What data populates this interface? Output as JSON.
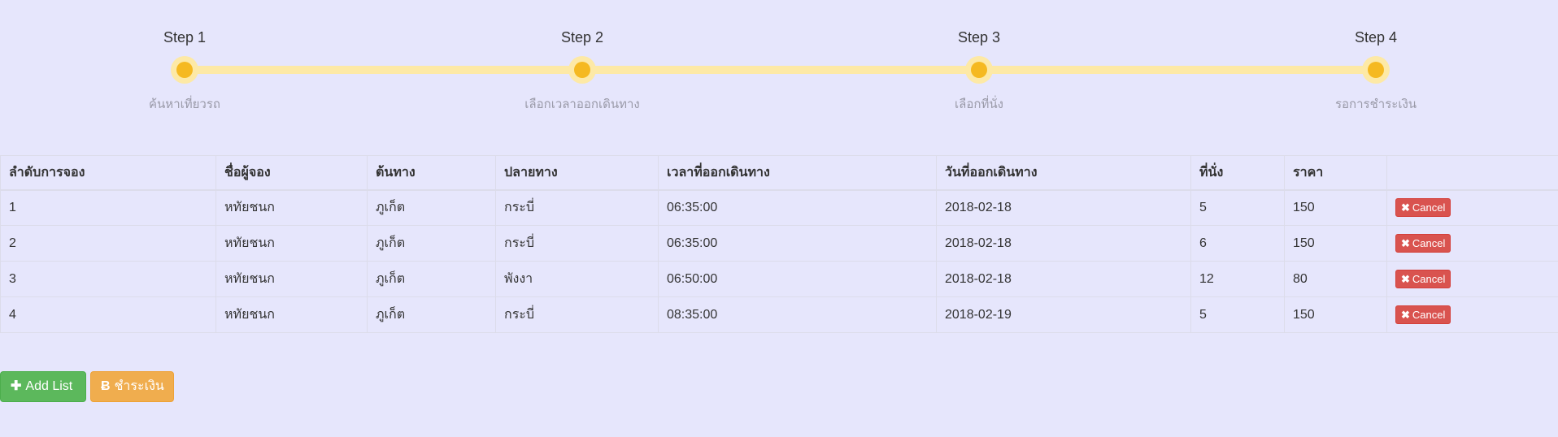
{
  "steps": [
    {
      "title": "Step 1",
      "desc": "ค้นหาเที่ยวรถ"
    },
    {
      "title": "Step 2",
      "desc": "เลือกเวลาออกเดินทาง"
    },
    {
      "title": "Step 3",
      "desc": "เลือกที่นั่ง"
    },
    {
      "title": "Step 4",
      "desc": "รอการชำระเงิน"
    }
  ],
  "table": {
    "headers": [
      "ลำดับการจอง",
      "ชื่อผู้จอง",
      "ต้นทาง",
      "ปลายทาง",
      "เวลาที่ออกเดินทาง",
      "วันที่ออกเดินทาง",
      "ที่นั่ง",
      "ราคา",
      ""
    ],
    "rows": [
      {
        "no": "1",
        "name": "หทัยชนก",
        "from": "ภูเก็ต",
        "to": "กระบี่",
        "time": "06:35:00",
        "date": "2018-02-18",
        "seat": "5",
        "price": "150"
      },
      {
        "no": "2",
        "name": "หทัยชนก",
        "from": "ภูเก็ต",
        "to": "กระบี่",
        "time": "06:35:00",
        "date": "2018-02-18",
        "seat": "6",
        "price": "150"
      },
      {
        "no": "3",
        "name": "หทัยชนก",
        "from": "ภูเก็ต",
        "to": "พังงา",
        "time": "06:50:00",
        "date": "2018-02-18",
        "seat": "12",
        "price": "80"
      },
      {
        "no": "4",
        "name": "หทัยชนก",
        "from": "ภูเก็ต",
        "to": "กระบี่",
        "time": "08:35:00",
        "date": "2018-02-19",
        "seat": "5",
        "price": "150"
      }
    ],
    "cancel_label": "Cancel",
    "cancel_icon": "✖"
  },
  "actions": {
    "add_label": "Add List",
    "add_icon": "✚",
    "pay_label": "ชำระเงิน",
    "pay_icon": "Ƀ"
  },
  "colors": {
    "background": "#e6e6fc",
    "step_track": "#fde9a6",
    "step_dot": "#f5b921",
    "cancel": "#d9534f",
    "add": "#5cb85c",
    "pay": "#f0ad4e"
  }
}
